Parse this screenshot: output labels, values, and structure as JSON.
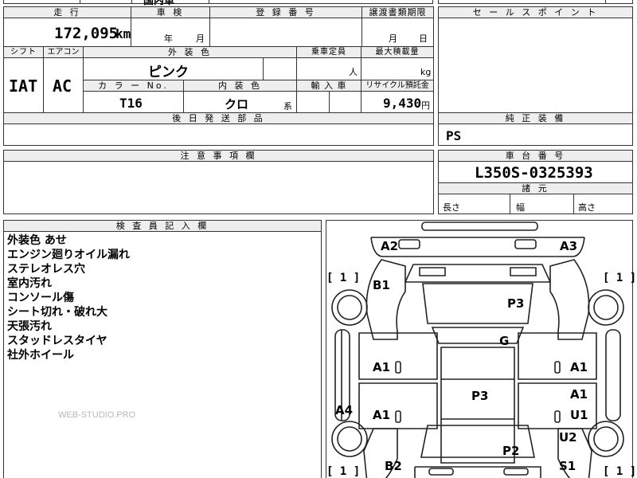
{
  "top_partial": {
    "text": "国内車"
  },
  "mileage": {
    "header": "走 行",
    "value": "172,095",
    "unit": "km"
  },
  "inspection": {
    "header": "車 検",
    "year_label": "年",
    "month_label": "月"
  },
  "registration": {
    "header": "登 録 番 号",
    "value": ""
  },
  "transfer_deadline": {
    "header": "譲渡書類期限",
    "month_label": "月",
    "day_label": "日"
  },
  "shift": {
    "header": "シフト",
    "value": "IAT"
  },
  "aircon": {
    "header": "エアコン",
    "value": "AC"
  },
  "exterior_color": {
    "header": "外 装 色",
    "value": "ピンク"
  },
  "capacity": {
    "header": "乗車定員",
    "unit": "人"
  },
  "max_load": {
    "header": "最大積載量",
    "unit": "kg"
  },
  "color_no": {
    "header": "カ ラ ー No.",
    "value": "T16"
  },
  "interior_color": {
    "header": "内 装 色",
    "value": "クロ",
    "suffix": "系"
  },
  "import_car": {
    "header": "輸 入 車"
  },
  "recycle_fee": {
    "header": "リサイクル預託金",
    "value": "9,430",
    "unit": "円"
  },
  "later_parts": {
    "header": "後 日 発 送 部 品"
  },
  "sales_point": {
    "header": "セ ー ル ス ポ イ ン ト"
  },
  "genuine_equipment": {
    "header": "純 正 装 備",
    "value": "PS"
  },
  "caution": {
    "header": "注 意 事 項 欄"
  },
  "chassis": {
    "header": "車 台 番 号",
    "value": "L350S-0325393"
  },
  "dimensions": {
    "header": "諸 元",
    "length": "長さ",
    "width": "幅",
    "height": "高さ"
  },
  "inspector_notes": {
    "header": "検 査 員 記 入 欄",
    "lines": [
      "外装色 あせ",
      "エンジン廻りオイル漏れ",
      "ステレオレス穴",
      "室内汚れ",
      "コンソール傷",
      "シート切れ・破れ大",
      "天張汚れ",
      "スタッドレスタイヤ",
      "社外ホイール"
    ],
    "watermark": "WEB-STUDIO.PRO"
  },
  "diagram": {
    "labels": {
      "a2": "A2",
      "a3": "A3",
      "b1": "B1",
      "p3_top": "P3",
      "g": "G",
      "a1_left_upper": "A1",
      "a1_right_upper": "A1",
      "p3_center": "P3",
      "a1_right_mid": "A1",
      "a4": "A4",
      "a1_left_lower": "A1",
      "u1": "U1",
      "u2": "U2",
      "p2": "P2",
      "b2": "B2",
      "s1": "S1"
    },
    "brackets": {
      "top_left": "[ 1 ]",
      "top_right": "[ 1 ]",
      "bottom_left": "[ 1 ]",
      "bottom_right": "[ 1 ]"
    }
  }
}
